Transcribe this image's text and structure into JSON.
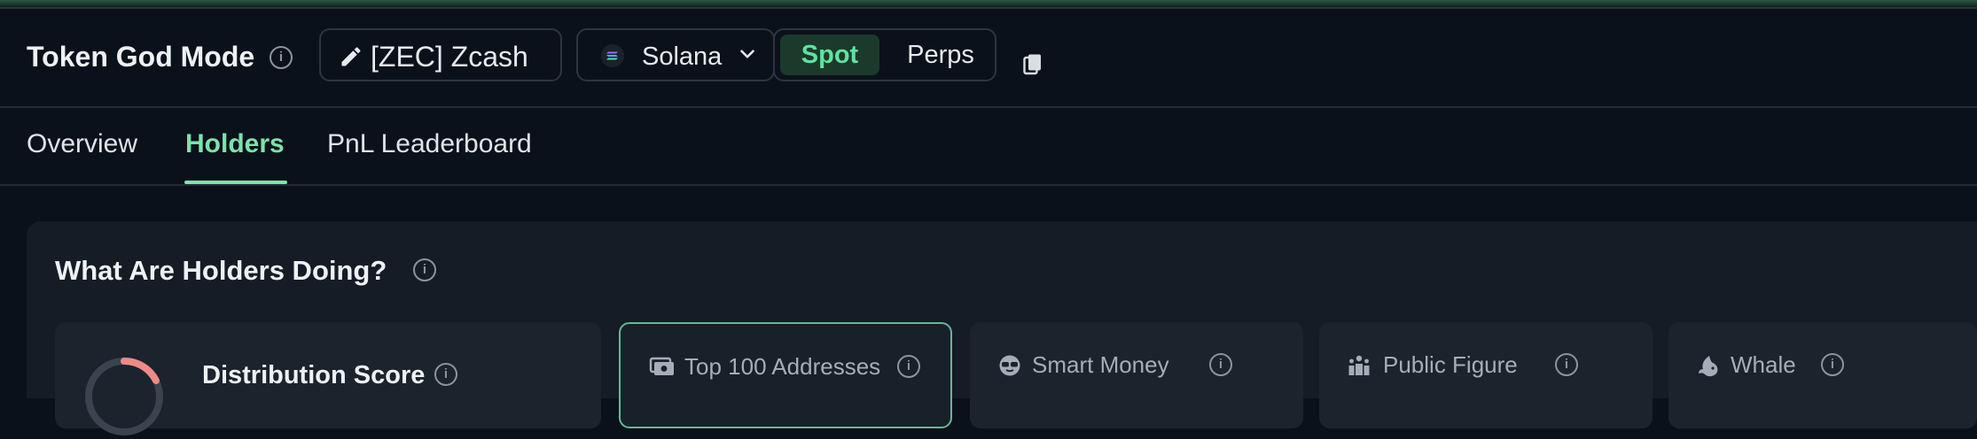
{
  "header": {
    "title": "Token God Mode",
    "token_label": "[ZEC] Zcash",
    "chain_label": "Solana",
    "market_tabs": {
      "spot": "Spot",
      "perps": "Perps"
    }
  },
  "tabs": [
    {
      "label": "Overview",
      "active": false
    },
    {
      "label": "Holders",
      "active": true
    },
    {
      "label": "PnL Leaderboard",
      "active": false
    }
  ],
  "panel": {
    "title": "What Are Holders Doing?",
    "distribution_label": "Distribution Score",
    "cards": [
      {
        "label": "Top 100 Addresses",
        "icon": "money-icon",
        "selected": true
      },
      {
        "label": "Smart Money",
        "icon": "sunglasses-icon",
        "selected": false
      },
      {
        "label": "Public Figure",
        "icon": "podium-icon",
        "selected": false
      },
      {
        "label": "Whale",
        "icon": "whale-icon",
        "selected": false
      }
    ]
  },
  "colors": {
    "accent": "#7ee2ab",
    "background": "#0b111a",
    "panel": "#151c25",
    "selected_border": "#63b996"
  }
}
